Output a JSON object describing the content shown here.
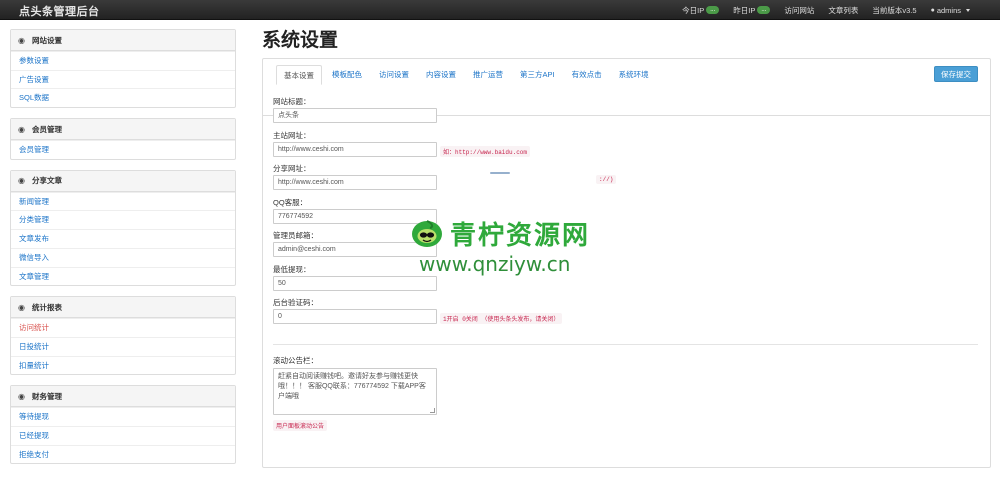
{
  "navbar": {
    "brand": "点头条管理后台",
    "links": [
      {
        "label": "今日IP",
        "badge": "..."
      },
      {
        "label": "昨日IP",
        "badge": "..."
      },
      {
        "label": "访问网站"
      },
      {
        "label": "文章列表"
      },
      {
        "label": "当前版本v3.5"
      }
    ],
    "user": "admins"
  },
  "sidebar": {
    "groups": [
      {
        "title": "网站设置",
        "items": [
          "参数设置",
          "广告设置",
          "SQL数据"
        ]
      },
      {
        "title": "会员管理",
        "items": [
          "会员管理"
        ]
      },
      {
        "title": "分享文章",
        "items": [
          "新闻管理",
          "分类管理",
          "文章发布",
          "微信导入",
          "文章管理"
        ]
      },
      {
        "title": "统计报表",
        "items": [
          "访问统计",
          "日投统计",
          "扣量统计"
        ]
      },
      {
        "title": "财务管理",
        "items": [
          "等待提现",
          "已经提现",
          "拒绝支付"
        ]
      }
    ]
  },
  "main": {
    "title": "系统设置",
    "tabs": [
      "基本设置",
      "模板配色",
      "访问设置",
      "内容设置",
      "推广运营",
      "第三方API",
      "有效点击",
      "系统环境"
    ],
    "save_label": "保存提交",
    "fields": [
      {
        "label": "网站标题：",
        "value": "点头条",
        "hint": ""
      },
      {
        "label": "主站网址：",
        "value": "http://www.ceshi.com",
        "hint": "如：http://www.baidu.com"
      },
      {
        "label": "分享网址：",
        "value": "http://www.ceshi.com",
        "hint": "://)"
      },
      {
        "label": "QQ客服：",
        "value": "776774592",
        "hint": ""
      },
      {
        "label": "管理员邮箱：",
        "value": "admin@ceshi.com",
        "hint": ""
      },
      {
        "label": "最低提现：",
        "value": "50",
        "hint": ""
      },
      {
        "label": "后台验证码：",
        "value": "0",
        "hint": "1开启 0关闭 （使用头条头发布，请关闭）"
      }
    ],
    "scroll_label": "滚动公告栏：",
    "scroll_text": "赶紧自动阅读赚钱吧。邀请好友参与赚钱更快哦！！！ 客服QQ联系：776774592 下载APP客户端哦",
    "scroll_hint": "用户面板滚动公告"
  },
  "watermark": {
    "cn": "青柠资源网",
    "url": "www.qnziyw.cn"
  }
}
